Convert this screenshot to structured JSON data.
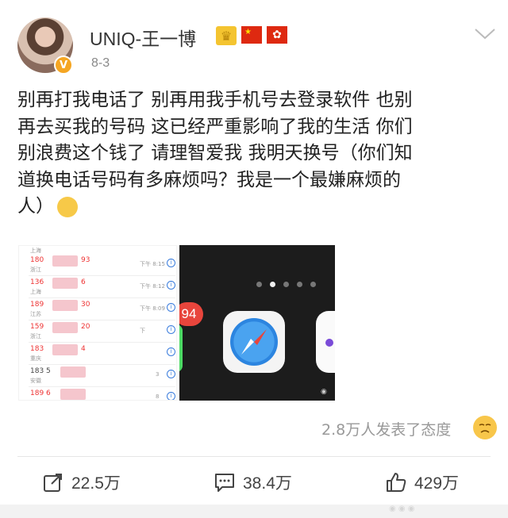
{
  "user": {
    "name": "UNIQ-王一博",
    "time": "8-3",
    "verified_mark": "V",
    "badges": [
      "crown-icon",
      "china-flag-icon",
      "hongkong-flag-icon"
    ]
  },
  "post": {
    "lines": [
      "别再打我电话了 别再用我手机号去登录软件 也别",
      "再去买我的号码 这已经严重影响了我的生活 你们",
      "别浪费这个钱了 请理智爱我 我明天换号（你们知",
      "道换电话号码有多麻烦吗？我是一个最嫌麻烦的",
      "人）"
    ]
  },
  "image1": {
    "calls": [
      {
        "number": "180",
        "suffix": "93",
        "location": "浙江",
        "time": "下午 8:15"
      },
      {
        "number": "136",
        "suffix": "6",
        "location": "上海",
        "time": "下午 8:12"
      },
      {
        "number": "189",
        "suffix": "30",
        "location": "江苏",
        "time": "下午 8:09"
      },
      {
        "number": "159",
        "suffix": "20",
        "location": "浙江",
        "time": "下"
      },
      {
        "number": "183",
        "suffix": "4",
        "location": "重庆",
        "time": ""
      },
      {
        "number": "183 5",
        "suffix": "",
        "location": "安徽",
        "time": "3"
      },
      {
        "number": "189 6",
        "suffix": "",
        "location": "",
        "time": "8"
      }
    ],
    "top_location": "上海"
  },
  "image2": {
    "badge_count": "94",
    "page_dots": 5,
    "active_dot": 1
  },
  "reactions": {
    "text": "2.8万人发表了态度"
  },
  "actions": {
    "repost": "22.5万",
    "comment": "38.4万",
    "like": "429万"
  },
  "colors": {
    "verified": "#f5a623",
    "red_number": "#e33333",
    "like_text": "#444444"
  }
}
